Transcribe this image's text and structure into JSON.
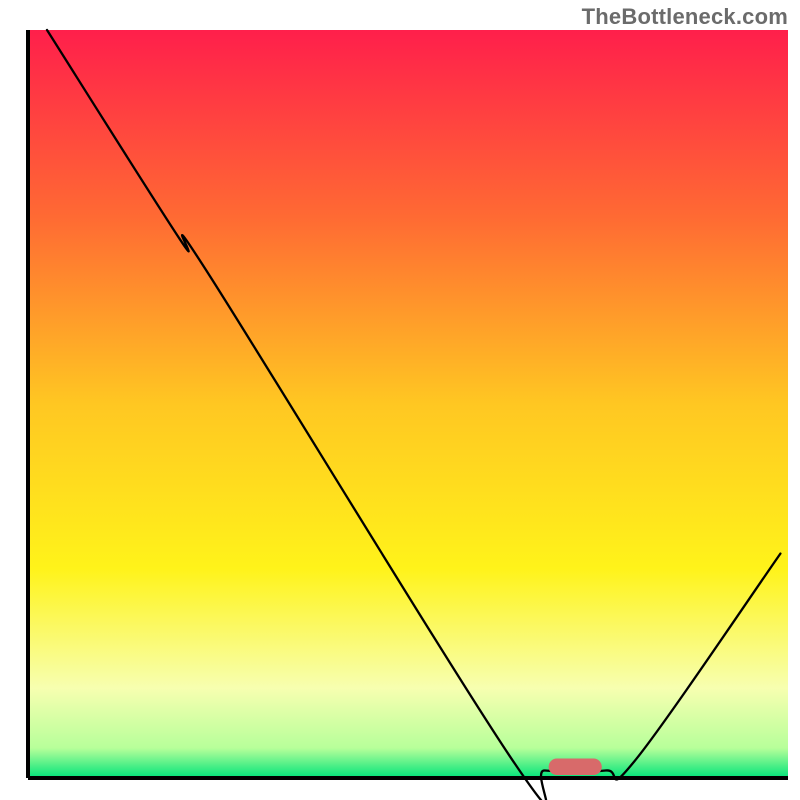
{
  "watermark": "TheBottleneck.com",
  "chart_data": {
    "type": "line",
    "title": "",
    "xlabel": "",
    "ylabel": "",
    "xlim": [
      0,
      100
    ],
    "ylim": [
      0,
      100
    ],
    "axes": {
      "left": true,
      "bottom": true,
      "top": false,
      "right": false,
      "ticks": false,
      "grid": false
    },
    "background_gradient": {
      "stops": [
        {
          "offset": 0.0,
          "color": "#ff1f4b"
        },
        {
          "offset": 0.25,
          "color": "#ff6a33"
        },
        {
          "offset": 0.5,
          "color": "#ffc722"
        },
        {
          "offset": 0.72,
          "color": "#fff31a"
        },
        {
          "offset": 0.88,
          "color": "#f7ffb0"
        },
        {
          "offset": 0.96,
          "color": "#b7ff9a"
        },
        {
          "offset": 1.0,
          "color": "#00e47a"
        }
      ]
    },
    "series": [
      {
        "name": "bottleneck-curve",
        "stroke": "#000000",
        "stroke_width": 2.3,
        "points": [
          {
            "x": 2.5,
            "y": 100.0
          },
          {
            "x": 20.0,
            "y": 72.0
          },
          {
            "x": 24.0,
            "y": 67.0
          },
          {
            "x": 64.0,
            "y": 2.0
          },
          {
            "x": 68.0,
            "y": 1.0
          },
          {
            "x": 76.0,
            "y": 1.0
          },
          {
            "x": 80.0,
            "y": 2.5
          },
          {
            "x": 99.0,
            "y": 30.0
          }
        ]
      }
    ],
    "marker": {
      "shape": "rounded-bar",
      "x": 72.0,
      "y": 1.5,
      "w": 7.0,
      "h": 2.2,
      "fill": "#d86a6a"
    }
  }
}
